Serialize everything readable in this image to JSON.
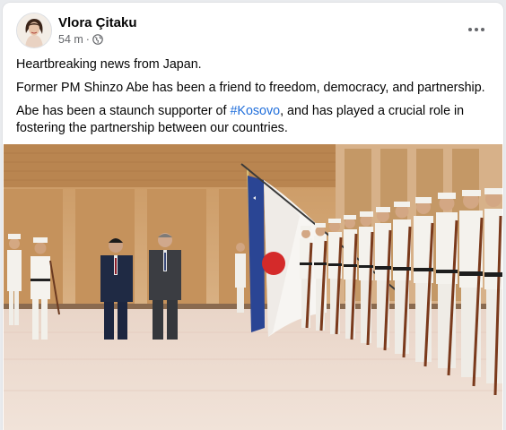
{
  "post": {
    "author": "Vlora Çitaku",
    "timestamp": "54 m",
    "separator": "·",
    "privacy_icon": "globe-icon",
    "more_icon": "more-horizontal-icon",
    "text": {
      "line1": "Heartbreaking news from Japan.",
      "line2": "Former PM Shinzo Abe has been a friend to freedom, democracy, and partnership.",
      "line3_before": "Abe has been a staunch supporter of ",
      "line3_hashtag": "#Kosovo",
      "line3_after": ", and has played a crucial role in fostering the partnership between our countries."
    },
    "colors": {
      "hashtag": "#216fdb",
      "author": "#050505",
      "meta": "#65676b"
    }
  }
}
